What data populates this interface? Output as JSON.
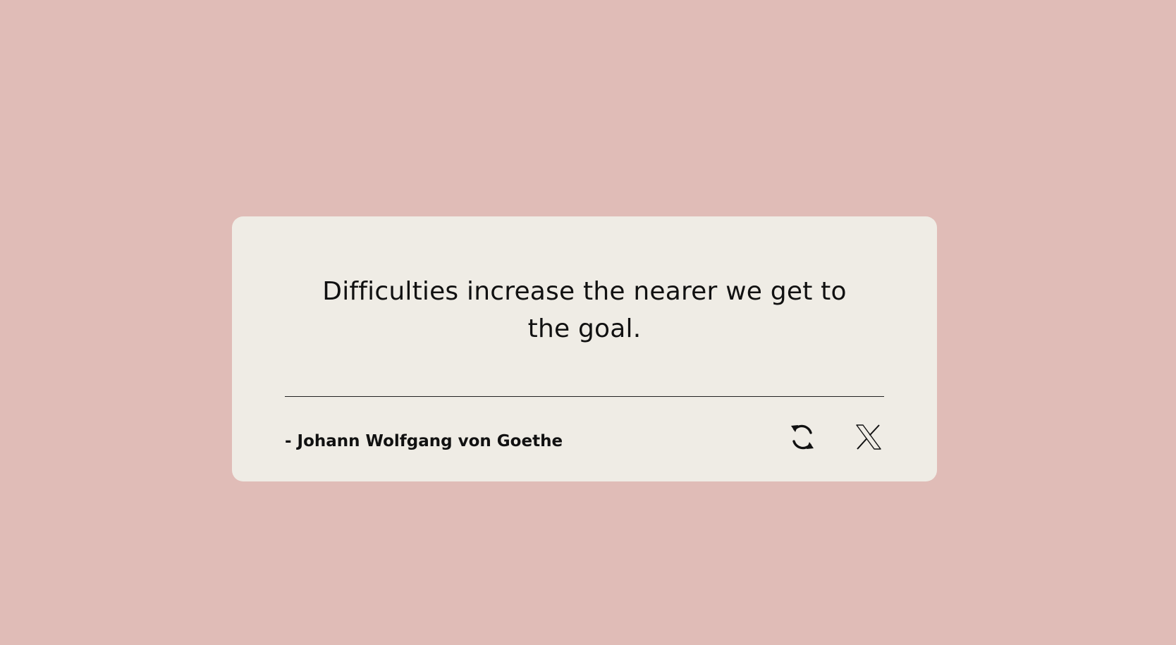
{
  "page": {
    "background_color": "#e0bcb7",
    "card_color": "#efece5",
    "text_color": "#111111"
  },
  "quote": {
    "text": "Difficulties increase the nearer we get to the goal.",
    "author": "- Johann Wolfgang von Goethe"
  },
  "actions": {
    "new_quote_icon": "refresh-icon",
    "share_icon": "x-logo-icon"
  }
}
